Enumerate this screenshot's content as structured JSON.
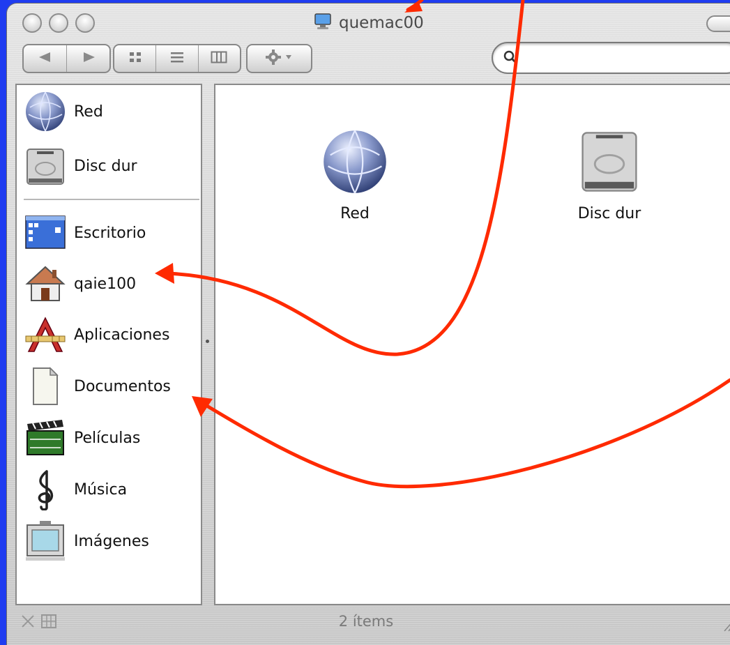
{
  "window": {
    "title": "quemac00",
    "status": "2 ítems"
  },
  "toolbar": {
    "back_icon": "back-arrow-icon",
    "forward_icon": "forward-arrow-icon",
    "views": [
      "icon-view-icon",
      "list-view-icon",
      "column-view-icon"
    ],
    "action_icon": "gear-icon",
    "search": {
      "placeholder": "",
      "value": ""
    }
  },
  "sidebar": {
    "devices": [
      {
        "label": "Red",
        "icon": "network-globe-icon"
      },
      {
        "label": "Disc dur",
        "icon": "hard-disk-icon"
      }
    ],
    "places": [
      {
        "label": "Escritorio",
        "icon": "desktop-icon"
      },
      {
        "label": "qaie100",
        "icon": "home-icon"
      },
      {
        "label": "Aplicaciones",
        "icon": "applications-icon"
      },
      {
        "label": "Documentos",
        "icon": "documents-icon"
      },
      {
        "label": "Películas",
        "icon": "movies-clapper-icon"
      },
      {
        "label": "Música",
        "icon": "music-clef-icon"
      },
      {
        "label": "Imágenes",
        "icon": "pictures-frame-icon"
      }
    ]
  },
  "content": {
    "items": [
      {
        "label": "Red",
        "icon": "network-globe-icon"
      },
      {
        "label": "Disc dur",
        "icon": "hard-disk-icon"
      }
    ]
  },
  "colors": {
    "background": "#1f3cf0",
    "annotation_arrow": "#ff2a00"
  }
}
